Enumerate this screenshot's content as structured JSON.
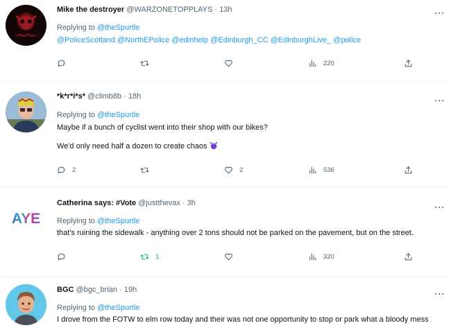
{
  "tweets": [
    {
      "name": "Mike the destroyer",
      "handle": "@WARZONETOPPLAYS",
      "dot": "·",
      "time": "13h",
      "replying_prefix": "Replying to",
      "replying_to": "@theSpurtle",
      "mentions": "@PoliceScotland @NorthEPolice @edinhelp @Edinburgh_CC @EdinburghLive_ @police",
      "text_lines": [],
      "reply_count": "",
      "retweet_count": "",
      "like_count": "",
      "views": "220"
    },
    {
      "name": "*k*r*i*s*",
      "handle": "@climb8b",
      "dot": "·",
      "time": "18h",
      "replying_prefix": "Replying to",
      "replying_to": "@theSpurtle",
      "text_lines": [
        "Maybe if a bunch of cyclist went into their shop with our bikes?",
        "We'd only need half a dozen to create chaos"
      ],
      "reply_count": "2",
      "retweet_count": "",
      "like_count": "2",
      "views": "536"
    },
    {
      "name": "Catherina says: #Vote",
      "handle": "@justthevax",
      "dot": "·",
      "time": "3h",
      "avatar_text": "AYE",
      "replying_prefix": "Replying to",
      "replying_to": "@theSpurtle",
      "text_lines": [
        "that's ruining the sidewalk - anything over 2 tons should not be parked on the pavement, but on the street."
      ],
      "reply_count": "",
      "retweet_count": "1",
      "like_count": "",
      "views": "320"
    },
    {
      "name": "BGC",
      "handle": "@bgc_brian",
      "dot": "·",
      "time": "19h",
      "replying_prefix": "Replying to",
      "replying_to": "@theSpurtle",
      "text_lines": [
        "I drove from the FOTW to elm row today and their was not one opportunity to stop or park what a bloody mess"
      ]
    }
  ],
  "more_label": "···",
  "colors": {
    "link": "#1d9bf0",
    "muted": "#536471",
    "retweet_active": "#00ba7c"
  },
  "icons": [
    "reply-icon",
    "retweet-icon",
    "like-icon",
    "views-icon",
    "share-icon",
    "more-icon",
    "devil-emoji"
  ]
}
